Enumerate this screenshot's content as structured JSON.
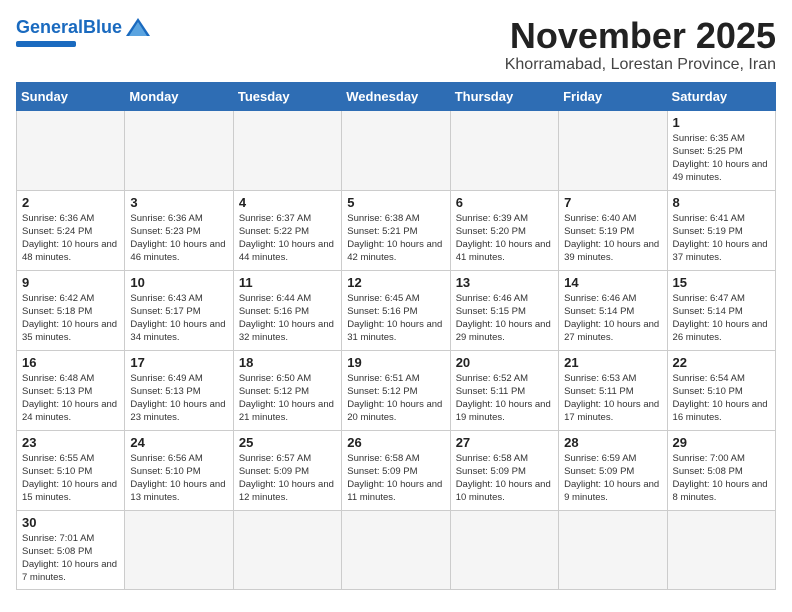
{
  "header": {
    "logo_general": "General",
    "logo_blue": "Blue",
    "month_title": "November 2025",
    "location": "Khorramabad, Lorestan Province, Iran"
  },
  "weekdays": [
    "Sunday",
    "Monday",
    "Tuesday",
    "Wednesday",
    "Thursday",
    "Friday",
    "Saturday"
  ],
  "weeks": [
    [
      {
        "day": "",
        "info": ""
      },
      {
        "day": "",
        "info": ""
      },
      {
        "day": "",
        "info": ""
      },
      {
        "day": "",
        "info": ""
      },
      {
        "day": "",
        "info": ""
      },
      {
        "day": "",
        "info": ""
      },
      {
        "day": "1",
        "info": "Sunrise: 6:35 AM\nSunset: 5:25 PM\nDaylight: 10 hours and 49 minutes."
      }
    ],
    [
      {
        "day": "2",
        "info": "Sunrise: 6:36 AM\nSunset: 5:24 PM\nDaylight: 10 hours and 48 minutes."
      },
      {
        "day": "3",
        "info": "Sunrise: 6:36 AM\nSunset: 5:23 PM\nDaylight: 10 hours and 46 minutes."
      },
      {
        "day": "4",
        "info": "Sunrise: 6:37 AM\nSunset: 5:22 PM\nDaylight: 10 hours and 44 minutes."
      },
      {
        "day": "5",
        "info": "Sunrise: 6:38 AM\nSunset: 5:21 PM\nDaylight: 10 hours and 42 minutes."
      },
      {
        "day": "6",
        "info": "Sunrise: 6:39 AM\nSunset: 5:20 PM\nDaylight: 10 hours and 41 minutes."
      },
      {
        "day": "7",
        "info": "Sunrise: 6:40 AM\nSunset: 5:19 PM\nDaylight: 10 hours and 39 minutes."
      },
      {
        "day": "8",
        "info": "Sunrise: 6:41 AM\nSunset: 5:19 PM\nDaylight: 10 hours and 37 minutes."
      }
    ],
    [
      {
        "day": "9",
        "info": "Sunrise: 6:42 AM\nSunset: 5:18 PM\nDaylight: 10 hours and 35 minutes."
      },
      {
        "day": "10",
        "info": "Sunrise: 6:43 AM\nSunset: 5:17 PM\nDaylight: 10 hours and 34 minutes."
      },
      {
        "day": "11",
        "info": "Sunrise: 6:44 AM\nSunset: 5:16 PM\nDaylight: 10 hours and 32 minutes."
      },
      {
        "day": "12",
        "info": "Sunrise: 6:45 AM\nSunset: 5:16 PM\nDaylight: 10 hours and 31 minutes."
      },
      {
        "day": "13",
        "info": "Sunrise: 6:46 AM\nSunset: 5:15 PM\nDaylight: 10 hours and 29 minutes."
      },
      {
        "day": "14",
        "info": "Sunrise: 6:46 AM\nSunset: 5:14 PM\nDaylight: 10 hours and 27 minutes."
      },
      {
        "day": "15",
        "info": "Sunrise: 6:47 AM\nSunset: 5:14 PM\nDaylight: 10 hours and 26 minutes."
      }
    ],
    [
      {
        "day": "16",
        "info": "Sunrise: 6:48 AM\nSunset: 5:13 PM\nDaylight: 10 hours and 24 minutes."
      },
      {
        "day": "17",
        "info": "Sunrise: 6:49 AM\nSunset: 5:13 PM\nDaylight: 10 hours and 23 minutes."
      },
      {
        "day": "18",
        "info": "Sunrise: 6:50 AM\nSunset: 5:12 PM\nDaylight: 10 hours and 21 minutes."
      },
      {
        "day": "19",
        "info": "Sunrise: 6:51 AM\nSunset: 5:12 PM\nDaylight: 10 hours and 20 minutes."
      },
      {
        "day": "20",
        "info": "Sunrise: 6:52 AM\nSunset: 5:11 PM\nDaylight: 10 hours and 19 minutes."
      },
      {
        "day": "21",
        "info": "Sunrise: 6:53 AM\nSunset: 5:11 PM\nDaylight: 10 hours and 17 minutes."
      },
      {
        "day": "22",
        "info": "Sunrise: 6:54 AM\nSunset: 5:10 PM\nDaylight: 10 hours and 16 minutes."
      }
    ],
    [
      {
        "day": "23",
        "info": "Sunrise: 6:55 AM\nSunset: 5:10 PM\nDaylight: 10 hours and 15 minutes."
      },
      {
        "day": "24",
        "info": "Sunrise: 6:56 AM\nSunset: 5:10 PM\nDaylight: 10 hours and 13 minutes."
      },
      {
        "day": "25",
        "info": "Sunrise: 6:57 AM\nSunset: 5:09 PM\nDaylight: 10 hours and 12 minutes."
      },
      {
        "day": "26",
        "info": "Sunrise: 6:58 AM\nSunset: 5:09 PM\nDaylight: 10 hours and 11 minutes."
      },
      {
        "day": "27",
        "info": "Sunrise: 6:58 AM\nSunset: 5:09 PM\nDaylight: 10 hours and 10 minutes."
      },
      {
        "day": "28",
        "info": "Sunrise: 6:59 AM\nSunset: 5:09 PM\nDaylight: 10 hours and 9 minutes."
      },
      {
        "day": "29",
        "info": "Sunrise: 7:00 AM\nSunset: 5:08 PM\nDaylight: 10 hours and 8 minutes."
      }
    ],
    [
      {
        "day": "30",
        "info": "Sunrise: 7:01 AM\nSunset: 5:08 PM\nDaylight: 10 hours and 7 minutes."
      },
      {
        "day": "",
        "info": ""
      },
      {
        "day": "",
        "info": ""
      },
      {
        "day": "",
        "info": ""
      },
      {
        "day": "",
        "info": ""
      },
      {
        "day": "",
        "info": ""
      },
      {
        "day": "",
        "info": ""
      }
    ]
  ]
}
